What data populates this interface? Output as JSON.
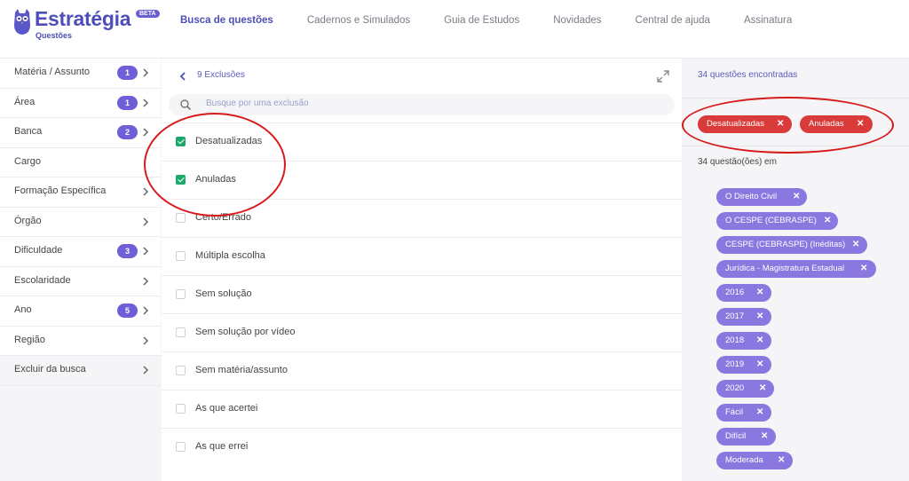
{
  "brand": {
    "name": "Estratégia",
    "sub": "Questões",
    "beta": "BETA",
    "color": "#4d4eb8"
  },
  "nav": [
    {
      "label": "Busca de questões",
      "active": true
    },
    {
      "label": "Cadernos e Simulados"
    },
    {
      "label": "Guia de Estudos"
    },
    {
      "label": "Novidades"
    },
    {
      "label": "Central de ajuda"
    },
    {
      "label": "Assinatura"
    }
  ],
  "sidebar": {
    "items": [
      {
        "label": "Matéria / Assunto",
        "badge": "1"
      },
      {
        "label": "Área",
        "badge": "1"
      },
      {
        "label": "Banca",
        "badge": "2"
      },
      {
        "label": "Cargo",
        "badge": ""
      },
      {
        "label": "Formação Específica",
        "badge": ""
      },
      {
        "label": "Órgão",
        "badge": ""
      },
      {
        "label": "Dificuldade",
        "badge": "3"
      },
      {
        "label": "Escolaridade",
        "badge": ""
      },
      {
        "label": "Ano",
        "badge": "5"
      },
      {
        "label": "Região",
        "badge": ""
      },
      {
        "label": "Excluir da busca",
        "badge": ""
      }
    ]
  },
  "exclusions": {
    "count_label": "9 Exclusões",
    "search_placeholder": "Busque por uma exclusão",
    "options": [
      {
        "label": "Desatualizadas",
        "checked": true
      },
      {
        "label": "Anuladas",
        "checked": true
      },
      {
        "label": "Certo/Errado",
        "checked": false
      },
      {
        "label": "Múltipla escolha",
        "checked": false
      },
      {
        "label": "Sem solução",
        "checked": false
      },
      {
        "label": "Sem solução por vídeo",
        "checked": false
      },
      {
        "label": "Sem matéria/assunto",
        "checked": false
      },
      {
        "label": "As que acertei",
        "checked": false
      },
      {
        "label": "As que errei",
        "checked": false
      }
    ]
  },
  "results": {
    "found_label": "34 questões encontradas",
    "excluded_tags": [
      "Desatualizadas",
      "Anuladas"
    ],
    "in_label": "34 questão(ões) em",
    "filter_tags": [
      "O Direito Civil",
      "O CESPE (CEBRASPE)",
      "CESPE (CEBRASPE) (Inéditas)",
      "Jurídica - Magistratura Estadual",
      "2016",
      "2017",
      "2018",
      "2019",
      "2020",
      "Fácil",
      "Difícil",
      "Moderada"
    ]
  },
  "colors": {
    "accent": "#6e5ed8",
    "tag_purple": "#8a77e0",
    "tag_red": "#d93a3a",
    "check_green": "#1aa96b",
    "annotation": "#d71a1a"
  },
  "icons": {
    "back": "chevron-left-icon",
    "expand": "expand-icon",
    "search": "search-icon",
    "remove": "close-icon",
    "chevron": "chevron-right-icon"
  }
}
